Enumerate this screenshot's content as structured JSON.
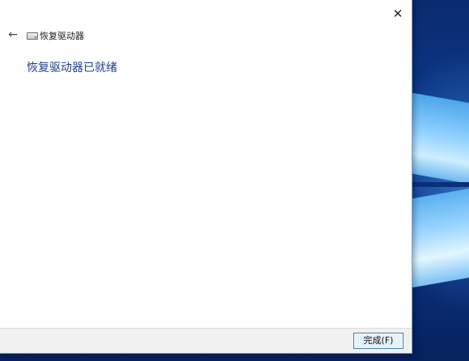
{
  "window": {
    "title": "恢复驱动器",
    "close_glyph": "✕",
    "back_glyph": "←",
    "drive_icon": "drive-icon"
  },
  "content": {
    "heading": "恢复驱动器已就绪"
  },
  "footer": {
    "finish_label": "完成(F)"
  },
  "colors": {
    "heading": "#1d3d8f",
    "desktop_accent": "#0b3a8c",
    "button_border": "#3c7fb1"
  }
}
